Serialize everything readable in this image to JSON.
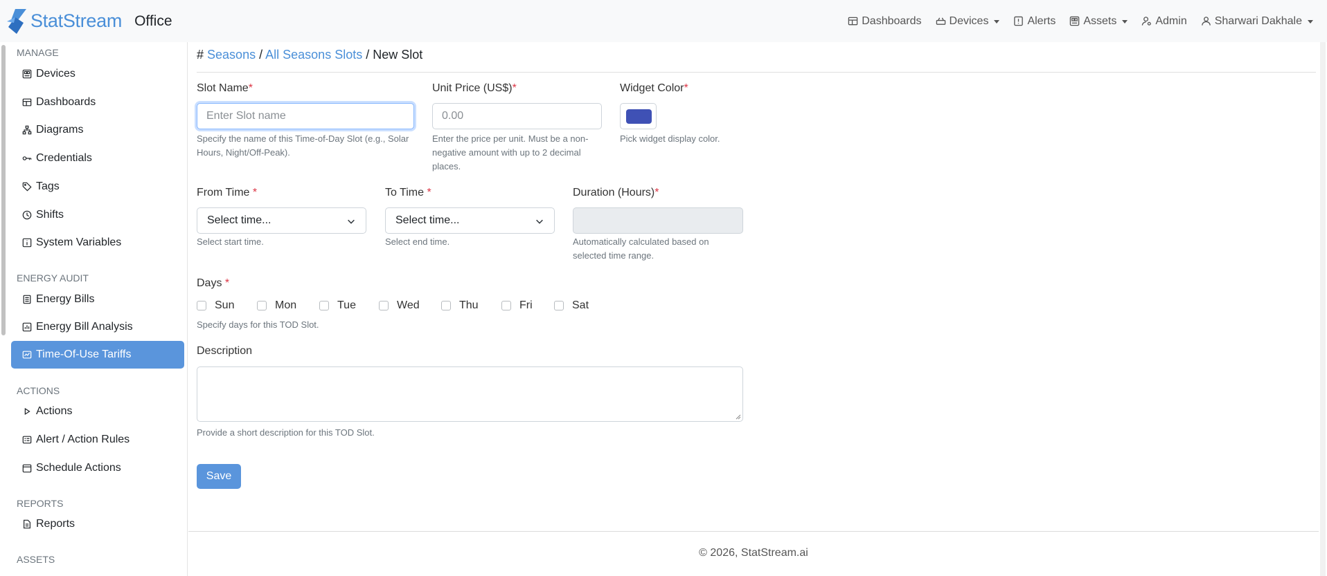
{
  "app": {
    "brand": "StatStream",
    "workspace": "Office",
    "accent_color": "#4a8fd8"
  },
  "nav": {
    "dashboards": "Dashboards",
    "devices": "Devices",
    "alerts": "Alerts",
    "assets": "Assets",
    "admin": "Admin",
    "user": "Sharwari Dakhale"
  },
  "sidebar": {
    "sections": [
      {
        "title": "MANAGE",
        "items": [
          {
            "label": "Devices",
            "icon": "device-icon"
          },
          {
            "label": "Dashboards",
            "icon": "dashboard-icon"
          },
          {
            "label": "Diagrams",
            "icon": "diagram-icon"
          },
          {
            "label": "Credentials",
            "icon": "key-icon"
          },
          {
            "label": "Tags",
            "icon": "tag-icon"
          },
          {
            "label": "Shifts",
            "icon": "clock-icon"
          },
          {
            "label": "System Variables",
            "icon": "info-icon"
          }
        ]
      },
      {
        "title": "ENERGY AUDIT",
        "items": [
          {
            "label": "Energy Bills",
            "icon": "bill-icon"
          },
          {
            "label": "Energy Bill Analysis",
            "icon": "chart-icon"
          },
          {
            "label": "Time-Of-Use Tariffs",
            "icon": "tariff-icon",
            "active": true
          }
        ]
      },
      {
        "title": "ACTIONS",
        "items": [
          {
            "label": "Actions",
            "icon": "play-icon"
          },
          {
            "label": "Alert / Action Rules",
            "icon": "rules-icon"
          },
          {
            "label": "Schedule Actions",
            "icon": "calendar-icon"
          }
        ]
      },
      {
        "title": "REPORTS",
        "items": [
          {
            "label": "Reports",
            "icon": "report-icon"
          }
        ]
      },
      {
        "title": "ASSETS",
        "items": []
      }
    ]
  },
  "breadcrumb": {
    "hash": "#",
    "seasons": "Seasons",
    "sep": "/",
    "all_slots": "All Seasons Slots",
    "current": "New Slot"
  },
  "form": {
    "slot_name": {
      "label": "Slot Name",
      "placeholder": "Enter Slot name",
      "hint": "Specify the name of this Time-of-Day Slot (e.g., Solar Hours, Night/Off-Peak)."
    },
    "unit_price": {
      "label": "Unit Price (US$)",
      "placeholder": "0.00",
      "hint": "Enter the price per unit. Must be a non-negative amount with up to 2 decimal places."
    },
    "widget_color": {
      "label": "Widget Color",
      "value": "#3f51b5",
      "hint": "Pick widget display color."
    },
    "from_time": {
      "label": "From Time",
      "value": "Select time...",
      "hint": "Select start time."
    },
    "to_time": {
      "label": "To Time",
      "value": "Select time...",
      "hint": "Select end time."
    },
    "duration": {
      "label": "Duration (Hours)",
      "hint": "Automatically calculated based on selected time range."
    },
    "days": {
      "label": "Days",
      "options": [
        "Sun",
        "Mon",
        "Tue",
        "Wed",
        "Thu",
        "Fri",
        "Sat"
      ],
      "hint": "Specify days for this TOD Slot."
    },
    "description": {
      "label": "Description",
      "hint": "Provide a short description for this TOD Slot."
    },
    "required_mark": "*",
    "save_label": "Save"
  },
  "footer": {
    "text": "© 2026, StatStream.ai"
  }
}
